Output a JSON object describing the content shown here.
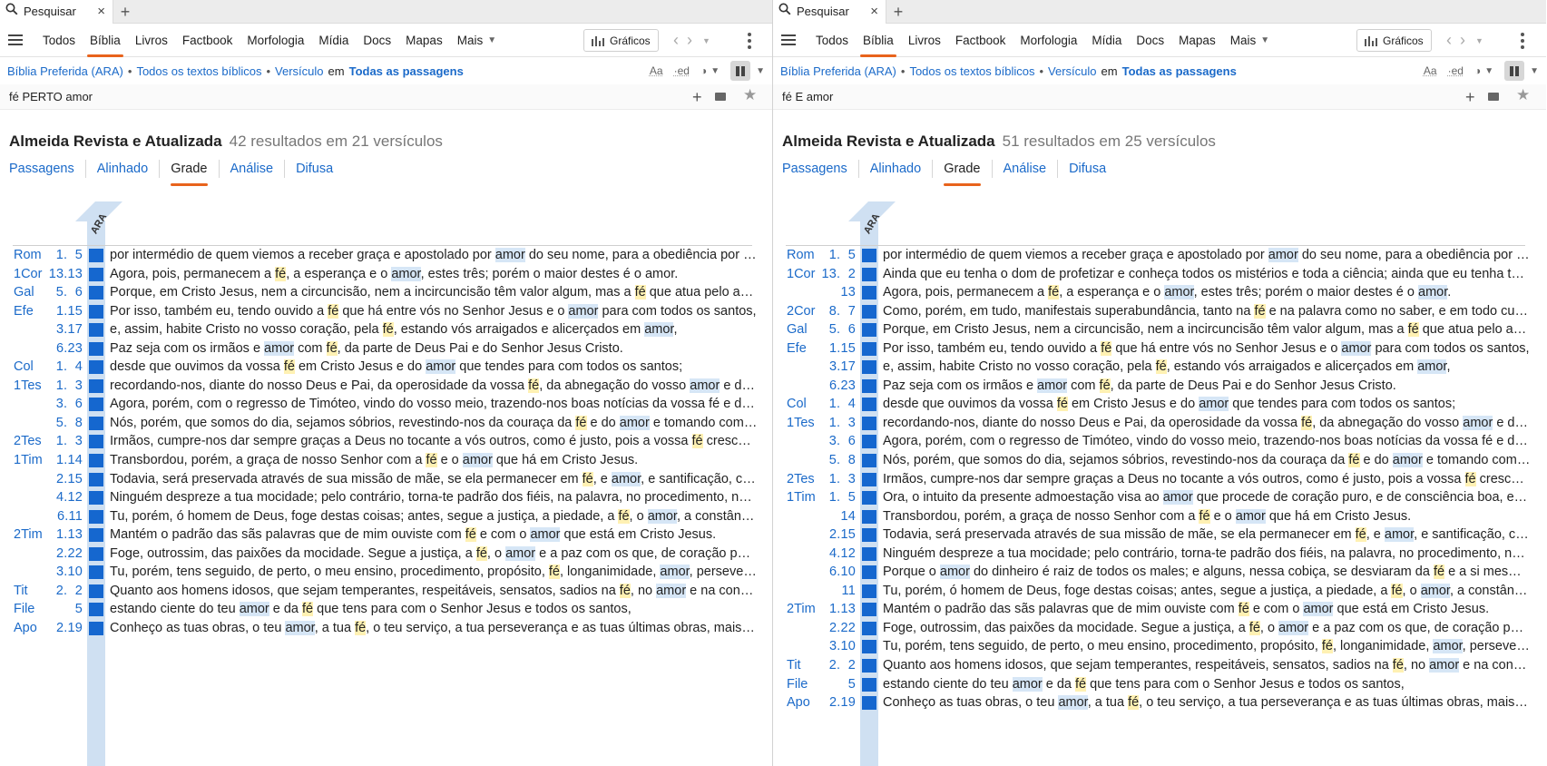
{
  "panels": [
    {
      "tab": {
        "label": "Pesquisar",
        "close": "×",
        "new": "+"
      },
      "nav": {
        "items": [
          "Todos",
          "Bíblia",
          "Livros",
          "Factbook",
          "Morfologia",
          "Mídia",
          "Docs",
          "Mapas",
          "Mais"
        ],
        "active": 1,
        "graficos": "Gráficos"
      },
      "context": {
        "bible": "Bíblia Preferida (ARA)",
        "texts": "Todos os textos bíblicos",
        "unit": "Versículo",
        "em": "em",
        "scope": "Todas as passagens",
        "aa": "Aa",
        "ed": "·ed"
      },
      "search": {
        "query": "fé PERTO amor"
      },
      "results": {
        "version": "Almeida Revista e Atualizada",
        "count": "42 resultados em 21 versículos"
      },
      "viewtabs": [
        "Passagens",
        "Alinhado",
        "Grade",
        "Análise",
        "Difusa"
      ],
      "active_view": 2,
      "column_label": "ARA",
      "rows": [
        {
          "book": "Rom",
          "ref": "1.  5",
          "text": "por intermédio de quem viemos a receber graça e apostolado por [[amor]] do seu nome, para a obediência por fé, entre todos os gentios,"
        },
        {
          "book": "1Cor",
          "ref": "13.13",
          "text": "Agora, pois, permanecem a {{fé}}, a esperança e o [[amor]], estes três; porém o maior destes é o amor."
        },
        {
          "book": "Gal",
          "ref": "5.  6",
          "text": "Porque, em Cristo Jesus, nem a circuncisão, nem a incircuncisão têm valor algum, mas a {{fé}} que atua pelo amor."
        },
        {
          "book": "Efe",
          "ref": "1.15",
          "text": "Por isso, também eu, tendo ouvido a {{fé}} que há entre vós no Senhor Jesus e o [[amor]] para com todos os santos,"
        },
        {
          "book": "",
          "ref": "3.17",
          "text": "e, assim, habite Cristo no vosso coração, pela {{fé}}, estando vós arraigados e alicerçados em [[amor]],"
        },
        {
          "book": "",
          "ref": "6.23",
          "text": "Paz seja com os irmãos e [[amor]] com {{fé}}, da parte de Deus Pai e do Senhor Jesus Cristo."
        },
        {
          "book": "Col",
          "ref": "1.  4",
          "text": "desde que ouvimos da vossa {{fé}} em Cristo Jesus e do [[amor]] que tendes para com todos os santos;"
        },
        {
          "book": "1Tes",
          "ref": "1.  3",
          "text": "recordando-nos, diante do nosso Deus e Pai, da operosidade da vossa {{fé}}, da abnegação do vosso [[amor]] e da firmeza da vossa esperança,"
        },
        {
          "book": "",
          "ref": "3.  6",
          "text": "Agora, porém, com o regresso de Timóteo, vindo do vosso meio, trazendo-nos boas notícias da vossa fé e do vosso amor,"
        },
        {
          "book": "",
          "ref": "5.  8",
          "text": "Nós, porém, que somos do dia, sejamos sóbrios, revestindo-nos da couraça da {{fé}} e do [[amor]] e tomando como capacete"
        },
        {
          "book": "2Tes",
          "ref": "1.  3",
          "text": "Irmãos, cumpre-nos dar sempre graças a Deus no tocante a vós outros, como é justo, pois a vossa {{fé}} cresce sobremaneira"
        },
        {
          "book": "1Tim",
          "ref": "1.14",
          "text": "Transbordou, porém, a graça de nosso Senhor com a {{fé}} e o [[amor]] que há em Cristo Jesus."
        },
        {
          "book": "",
          "ref": "2.15",
          "text": "Todavia, será preservada através de sua missão de mãe, se ela permanecer em {{fé}}, e [[amor]], e santificação, com bom senso."
        },
        {
          "book": "",
          "ref": "4.12",
          "text": "Ninguém despreze a tua mocidade; pelo contrário, torna-te padrão dos fiéis, na palavra, no procedimento, no amor, na fé"
        },
        {
          "book": "",
          "ref": "6.11",
          "text": "Tu, porém, ó homem de Deus, foge destas coisas; antes, segue a justiça, a piedade, a {{fé}}, o [[amor]], a constância, a mansidão."
        },
        {
          "book": "2Tim",
          "ref": "1.13",
          "text": "Mantém o padrão das sãs palavras que de mim ouviste com {{fé}} e com o [[amor]] que está em Cristo Jesus."
        },
        {
          "book": "",
          "ref": "2.22",
          "text": "Foge, outrossim, das paixões da mocidade. Segue a justiça, a {{fé}}, o [[amor]] e a paz com os que, de coração puro, invocam o Senhor."
        },
        {
          "book": "",
          "ref": "3.10",
          "text": "Tu, porém, tens seguido, de perto, o meu ensino, procedimento, propósito, {{fé}}, longanimidade, [[amor]], perseverança,"
        },
        {
          "book": "Tit",
          "ref": "2.  2",
          "text": "Quanto aos homens idosos, que sejam temperantes, respeitáveis, sensatos, sadios na {{fé}}, no [[amor]] e na constância."
        },
        {
          "book": "File",
          "ref": "5",
          "text": "estando ciente do teu [[amor]] e da {{fé}} que tens para com o Senhor Jesus e todos os santos,"
        },
        {
          "book": "Apo",
          "ref": "2.19",
          "text": "Conheço as tuas obras, o teu [[amor]], a tua {{fé}}, o teu serviço, a tua perseverança e as tuas últimas obras, mais numerosas do que as primeiras."
        }
      ]
    },
    {
      "tab": {
        "label": "Pesquisar",
        "close": "×",
        "new": "+"
      },
      "nav": {
        "items": [
          "Todos",
          "Bíblia",
          "Livros",
          "Factbook",
          "Morfologia",
          "Mídia",
          "Docs",
          "Mapas",
          "Mais"
        ],
        "active": 1,
        "graficos": "Gráficos"
      },
      "context": {
        "bible": "Bíblia Preferida (ARA)",
        "texts": "Todos os textos bíblicos",
        "unit": "Versículo",
        "em": "em",
        "scope": "Todas as passagens",
        "aa": "Aa",
        "ed": "·ed"
      },
      "search": {
        "query": "fé E amor"
      },
      "results": {
        "version": "Almeida Revista e Atualizada",
        "count": "51 resultados em 25 versículos"
      },
      "viewtabs": [
        "Passagens",
        "Alinhado",
        "Grade",
        "Análise",
        "Difusa"
      ],
      "active_view": 2,
      "column_label": "ARA",
      "rows": [
        {
          "book": "Rom",
          "ref": "1.  5",
          "text": "por intermédio de quem viemos a receber graça e apostolado por [[amor]] do seu nome, para a obediência por fé, entre todos os gentios,"
        },
        {
          "book": "1Cor",
          "ref": "13.  2",
          "text": "Ainda que eu tenha o dom de profetizar e conheça todos os mistérios e toda a ciência; ainda que eu tenha tamanha fé,"
        },
        {
          "book": "",
          "ref": "13",
          "text": "Agora, pois, permanecem a {{fé}}, a esperança e o [[amor]], estes três; porém o maior destes é o [[amor]]."
        },
        {
          "book": "2Cor",
          "ref": "8.  7",
          "text": "Como, porém, em tudo, manifestais superabundância, tanto na {{fé}} e na palavra como no saber, e em todo cuidado,"
        },
        {
          "book": "Gal",
          "ref": "5.  6",
          "text": "Porque, em Cristo Jesus, nem a circuncisão, nem a incircuncisão têm valor algum, mas a {{fé}} que atua pelo amor."
        },
        {
          "book": "Efe",
          "ref": "1.15",
          "text": "Por isso, também eu, tendo ouvido a {{fé}} que há entre vós no Senhor Jesus e o [[amor]] para com todos os santos,"
        },
        {
          "book": "",
          "ref": "3.17",
          "text": "e, assim, habite Cristo no vosso coração, pela {{fé}}, estando vós arraigados e alicerçados em [[amor]],"
        },
        {
          "book": "",
          "ref": "6.23",
          "text": "Paz seja com os irmãos e [[amor]] com {{fé}}, da parte de Deus Pai e do Senhor Jesus Cristo."
        },
        {
          "book": "Col",
          "ref": "1.  4",
          "text": "desde que ouvimos da vossa {{fé}} em Cristo Jesus e do [[amor]] que tendes para com todos os santos;"
        },
        {
          "book": "1Tes",
          "ref": "1.  3",
          "text": "recordando-nos, diante do nosso Deus e Pai, da operosidade da vossa {{fé}}, da abnegação do vosso [[amor]] e da firmeza"
        },
        {
          "book": "",
          "ref": "3.  6",
          "text": "Agora, porém, com o regresso de Timóteo, vindo do vosso meio, trazendo-nos boas notícias da vossa fé e do vosso amor,"
        },
        {
          "book": "",
          "ref": "5.  8",
          "text": "Nós, porém, que somos do dia, sejamos sóbrios, revestindo-nos da couraça da {{fé}} e do [[amor]] e tomando como capacete"
        },
        {
          "book": "2Tes",
          "ref": "1.  3",
          "text": "Irmãos, cumpre-nos dar sempre graças a Deus no tocante a vós outros, como é justo, pois a vossa {{fé}} cresce sobremaneira"
        },
        {
          "book": "1Tim",
          "ref": "1.  5",
          "text": "Ora, o intuito da presente admoestação visa ao [[amor]] que procede de coração puro, e de consciência boa, e de fé sem hipocrisia."
        },
        {
          "book": "",
          "ref": "14",
          "text": "Transbordou, porém, a graça de nosso Senhor com a {{fé}} e o [[amor]] que há em Cristo Jesus."
        },
        {
          "book": "",
          "ref": "2.15",
          "text": "Todavia, será preservada através de sua missão de mãe, se ela permanecer em {{fé}}, e [[amor]], e santificação, com bom senso."
        },
        {
          "book": "",
          "ref": "4.12",
          "text": "Ninguém despreze a tua mocidade; pelo contrário, torna-te padrão dos fiéis, na palavra, no procedimento, no amor, na fé"
        },
        {
          "book": "",
          "ref": "6.10",
          "text": "Porque o [[amor]] do dinheiro é raiz de todos os males; e alguns, nessa cobiça, se desviaram da {{fé}} e a si mesmos se atormentaram"
        },
        {
          "book": "",
          "ref": "11",
          "text": "Tu, porém, ó homem de Deus, foge destas coisas; antes, segue a justiça, a piedade, a {{fé}}, o [[amor]], a constância, a mansidão."
        },
        {
          "book": "2Tim",
          "ref": "1.13",
          "text": "Mantém o padrão das sãs palavras que de mim ouviste com {{fé}} e com o [[amor]] que está em Cristo Jesus."
        },
        {
          "book": "",
          "ref": "2.22",
          "text": "Foge, outrossim, das paixões da mocidade. Segue a justiça, a {{fé}}, o [[amor]] e a paz com os que, de coração puro, invocam o Senhor."
        },
        {
          "book": "",
          "ref": "3.10",
          "text": "Tu, porém, tens seguido, de perto, o meu ensino, procedimento, propósito, {{fé}}, longanimidade, [[amor]], perseverança,"
        },
        {
          "book": "Tit",
          "ref": "2.  2",
          "text": "Quanto aos homens idosos, que sejam temperantes, respeitáveis, sensatos, sadios na {{fé}}, no [[amor]] e na constância."
        },
        {
          "book": "File",
          "ref": "5",
          "text": "estando ciente do teu [[amor]] e da {{fé}} que tens para com o Senhor Jesus e todos os santos,"
        },
        {
          "book": "Apo",
          "ref": "2.19",
          "text": "Conheço as tuas obras, o teu [[amor]], a tua {{fé}}, o teu serviço, a tua perseverança e as tuas últimas obras, mais numerosas do que as primeiras."
        }
      ]
    }
  ],
  "colors": {
    "accent": "#e8631c",
    "link": "#1b6ac9",
    "cell": "#1567cf",
    "strip": "#cfe0f2",
    "faith_highlight": "#fff1b3",
    "love_highlight": "#d6e6f6"
  },
  "icons": [
    "search-icon",
    "close-icon",
    "plus-icon",
    "menu-icon",
    "chart-icon",
    "back-icon",
    "forward-icon",
    "kebab-icon",
    "text-size-icon",
    "visual-filter-icon",
    "layout-icon",
    "add-icon",
    "keyboard-icon",
    "star-icon"
  ]
}
